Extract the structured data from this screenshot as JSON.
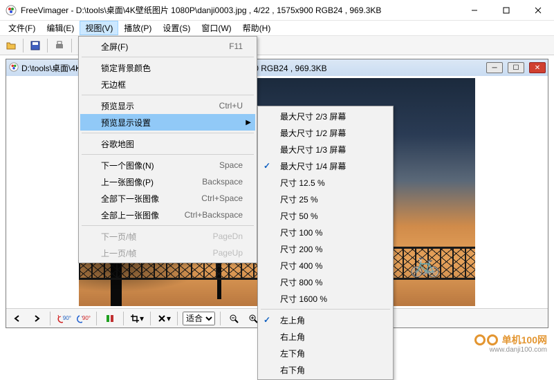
{
  "app": {
    "name": "FreeVimager",
    "title": "FreeVimager - D:\\tools\\桌面\\4K壁纸图片 1080P\\danji0003.jpg , 4/22 , 1575x900 RGB24 , 969.3KB"
  },
  "menubar": {
    "items": [
      "文件(F)",
      "编辑(E)",
      "视图(V)",
      "播放(P)",
      "设置(S)",
      "窗口(W)",
      "帮助(H)"
    ],
    "active_index": 2
  },
  "child": {
    "title": "D:\\tools\\桌面\\4K壁纸图片 1080P\\danji0003.jpg , 4/22 , 1575x900 RGB24 , 969.3KB"
  },
  "view_menu": {
    "fullscreen": {
      "label": "全屏(F)",
      "shortcut": "F11"
    },
    "lock_bg": {
      "label": "锁定背景颜色"
    },
    "no_border": {
      "label": "无边框"
    },
    "preview_show": {
      "label": "预览显示",
      "shortcut": "Ctrl+U"
    },
    "preview_settings": {
      "label": "预览显示设置"
    },
    "google_maps": {
      "label": "谷歌地图"
    },
    "next_image": {
      "label": "下一个图像(N)",
      "shortcut": "Space"
    },
    "prev_image": {
      "label": "上一张图像(P)",
      "shortcut": "Backspace"
    },
    "all_next": {
      "label": "全部下一张图像",
      "shortcut": "Ctrl+Space"
    },
    "all_prev": {
      "label": "全部上一张图像",
      "shortcut": "Ctrl+Backspace"
    },
    "next_page": {
      "label": "下一页/帧",
      "shortcut": "PageDn"
    },
    "prev_page": {
      "label": "上一页/帧",
      "shortcut": "PageUp"
    }
  },
  "submenu": {
    "items": [
      {
        "label": "最大尺寸 2/3 屏幕",
        "checked": false
      },
      {
        "label": "最大尺寸 1/2 屏幕",
        "checked": false
      },
      {
        "label": "最大尺寸 1/3 屏幕",
        "checked": false
      },
      {
        "label": "最大尺寸 1/4 屏幕",
        "checked": true
      },
      {
        "label": "尺寸 12.5 %",
        "checked": false
      },
      {
        "label": "尺寸 25 %",
        "checked": false
      },
      {
        "label": "尺寸 50 %",
        "checked": false
      },
      {
        "label": "尺寸 100 %",
        "checked": false
      },
      {
        "label": "尺寸 200 %",
        "checked": false
      },
      {
        "label": "尺寸 400 %",
        "checked": false
      },
      {
        "label": "尺寸 800 %",
        "checked": false
      },
      {
        "label": "尺寸 1600 %",
        "checked": false
      }
    ],
    "corners": [
      {
        "label": "左上角",
        "checked": true
      },
      {
        "label": "右上角",
        "checked": false
      },
      {
        "label": "左下角",
        "checked": false
      },
      {
        "label": "右下角",
        "checked": false
      }
    ]
  },
  "statusbar": {
    "fit": "适合"
  },
  "watermark": {
    "brand": "单机100网",
    "url": "www.danji100.com"
  }
}
